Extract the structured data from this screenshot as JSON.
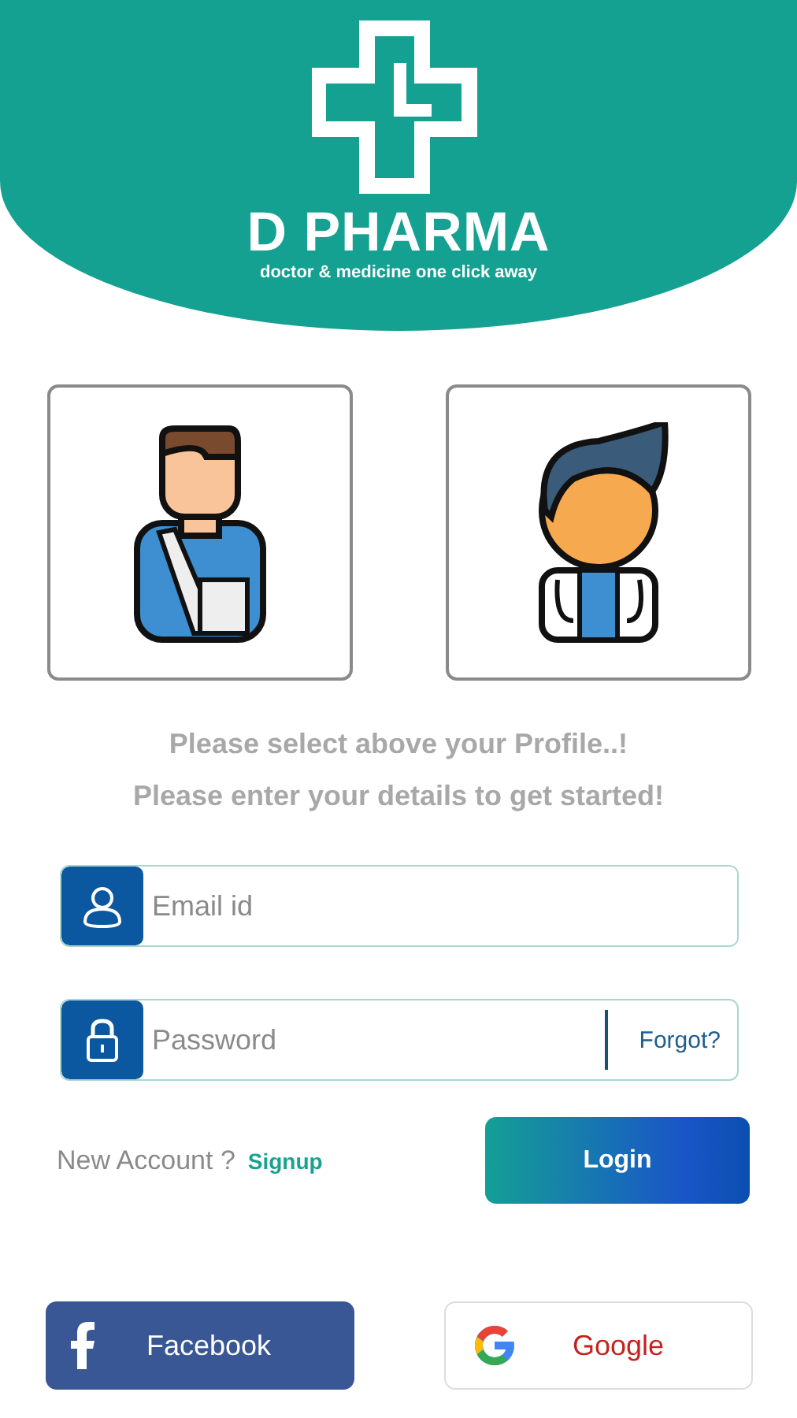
{
  "header": {
    "title": "D PHARMA",
    "tagline": "doctor & medicine one click away"
  },
  "profiles": [
    {
      "kind": "patient"
    },
    {
      "kind": "doctor"
    }
  ],
  "instructions": [
    "Please select above your Profile..!",
    "Please enter  your details to get started!"
  ],
  "fields": [
    {
      "kind": "user",
      "placeholder": "Email id"
    },
    {
      "kind": "lock",
      "placeholder": "Password",
      "action": "Forgot?"
    }
  ],
  "signup": {
    "prompt": "New Account ?",
    "link": "Signup"
  },
  "login_button": "Login",
  "social": [
    {
      "kind": "facebook",
      "label": "Facebook"
    },
    {
      "kind": "google",
      "label": "Google"
    }
  ]
}
